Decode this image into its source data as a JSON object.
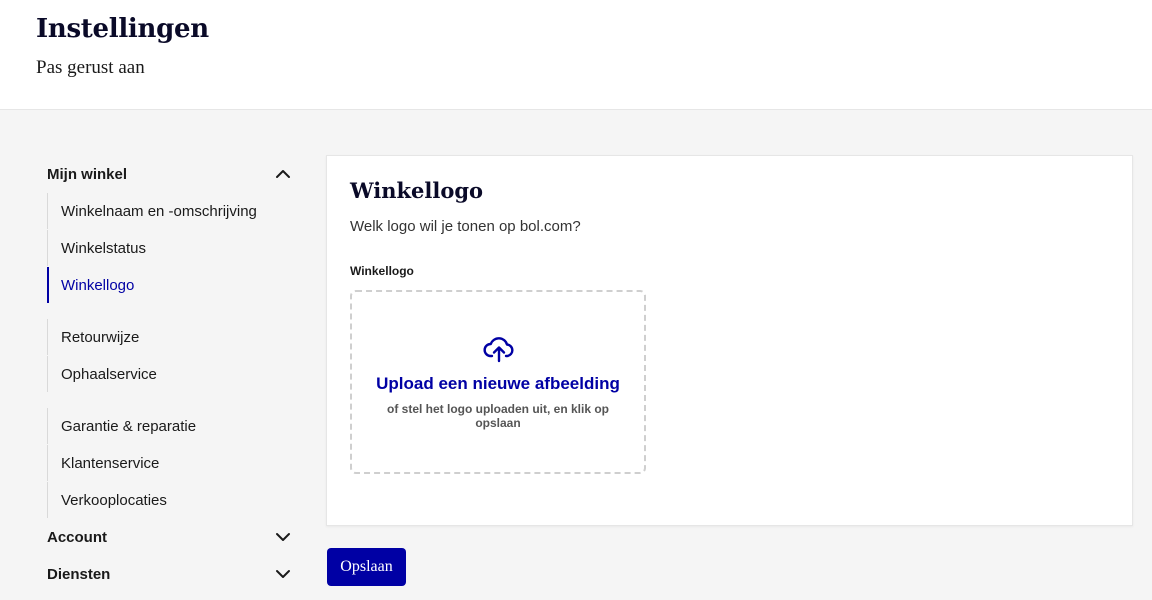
{
  "header": {
    "title": "Instellingen",
    "subtitle": "Pas gerust aan"
  },
  "sidebar": {
    "groups": [
      {
        "label": "Mijn winkel",
        "expanded": true,
        "chevron_icon": "chevron-up-icon",
        "items": [
          {
            "label": "Winkelnaam en -omschrijving",
            "active": false
          },
          {
            "label": "Winkelstatus",
            "active": false
          },
          {
            "label": "Winkellogo",
            "active": true
          },
          {
            "label": "Retourwijze",
            "active": false
          },
          {
            "label": "Ophaalservice",
            "active": false
          },
          {
            "label": "Garantie & reparatie",
            "active": false
          },
          {
            "label": "Klantenservice",
            "active": false
          },
          {
            "label": "Verkooplocaties",
            "active": false
          }
        ]
      },
      {
        "label": "Account",
        "expanded": false,
        "chevron_icon": "chevron-down-icon"
      },
      {
        "label": "Diensten",
        "expanded": false,
        "chevron_icon": "chevron-down-icon"
      }
    ]
  },
  "card": {
    "title": "Winkellogo",
    "description": "Welk logo wil je tonen op bol.com?",
    "field_label": "Winkellogo",
    "upload": {
      "icon": "cloud-upload-icon",
      "title": "Upload een nieuwe afbeelding",
      "hint": "of stel het logo uploaden uit, en klik op opslaan"
    }
  },
  "actions": {
    "save_label": "Opslaan"
  },
  "colors": {
    "accent": "#0000a4",
    "heading": "#0a0a28",
    "background": "#f5f5f5"
  }
}
